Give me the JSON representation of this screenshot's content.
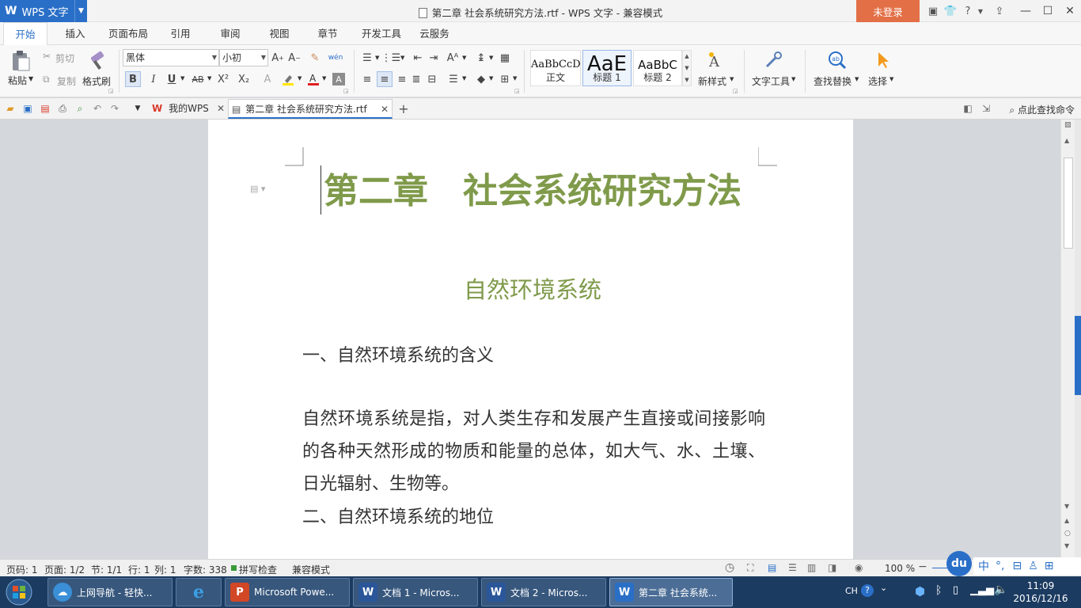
{
  "titlebar": {
    "app_logo": "W",
    "app_name": "WPS 文字",
    "doc_title": "第二章  社会系统研究方法.rtf - WPS 文字 - 兼容模式",
    "login_button": "未登录",
    "help": "?"
  },
  "menu": {
    "tabs": [
      "开始",
      "插入",
      "页面布局",
      "引用",
      "审阅",
      "视图",
      "章节",
      "开发工具",
      "云服务"
    ],
    "active": "开始"
  },
  "ribbon": {
    "paste": "粘贴",
    "cut": "剪切",
    "copy": "复制",
    "format_painter": "格式刷",
    "font_name": "黑体",
    "font_size": "小初",
    "bold": "B",
    "italic": "I",
    "underline": "U",
    "strike": "AB",
    "superscript": "X²",
    "subscript": "X₂",
    "styles": [
      {
        "preview": "AaBbCcD",
        "name": "正文"
      },
      {
        "preview": "AaE",
        "name": "标题 1"
      },
      {
        "preview": "AaBbC",
        "name": "标题 2"
      }
    ],
    "new_style": "新样式",
    "text_tools": "文字工具",
    "find_replace": "查找替换",
    "select": "选择"
  },
  "quickbar": {
    "tab_home": "我的WPS",
    "tab_doc": "第二章  社会系统研究方法.rtf",
    "command_search": "点此查找命令"
  },
  "document": {
    "title": "第二章　社会系统研究方法",
    "subtitle": "自然环境系统",
    "heading1": "一、自然环境系统的含义",
    "paragraph": "自然环境系统是指，对人类生存和发展产生直接或间接影响的各种天然形成的物质和能量的总体，如大气、水、土壤、日光辐射、生物等。",
    "heading2": "二、自然环境系统的地位"
  },
  "statusbar": {
    "page_code": "页码: 1",
    "page": "页面: 1/2",
    "section": "节: 1/1",
    "row": "行: 1",
    "col": "列: 1",
    "word_count": "字数: 338",
    "spell_check": "拼写检查",
    "compat_mode": "兼容模式",
    "zoom": "100 %"
  },
  "taskbar": {
    "buttons": [
      {
        "label": "上网导航 - 轻快...",
        "icon": "browser-cloud-icon"
      },
      {
        "label": "",
        "icon": "ie-icon"
      },
      {
        "label": "Microsoft Powe...",
        "icon": "powerpoint-icon"
      },
      {
        "label": "文档 1 - Micros...",
        "icon": "word-icon"
      },
      {
        "label": "文档 2 - Micros...",
        "icon": "word-icon"
      },
      {
        "label": "第二章  社会系统...",
        "icon": "wps-writer-icon"
      }
    ],
    "ime_lang": "CH",
    "time": "11:09",
    "date": "2016/12/16"
  },
  "ime": {
    "logo": "du",
    "mode": "中"
  },
  "colors": {
    "accent_blue": "#2a6fc7",
    "heading_green": "#7f9a4a",
    "login_orange": "#e36f46",
    "taskbar": "#1c3b61"
  }
}
